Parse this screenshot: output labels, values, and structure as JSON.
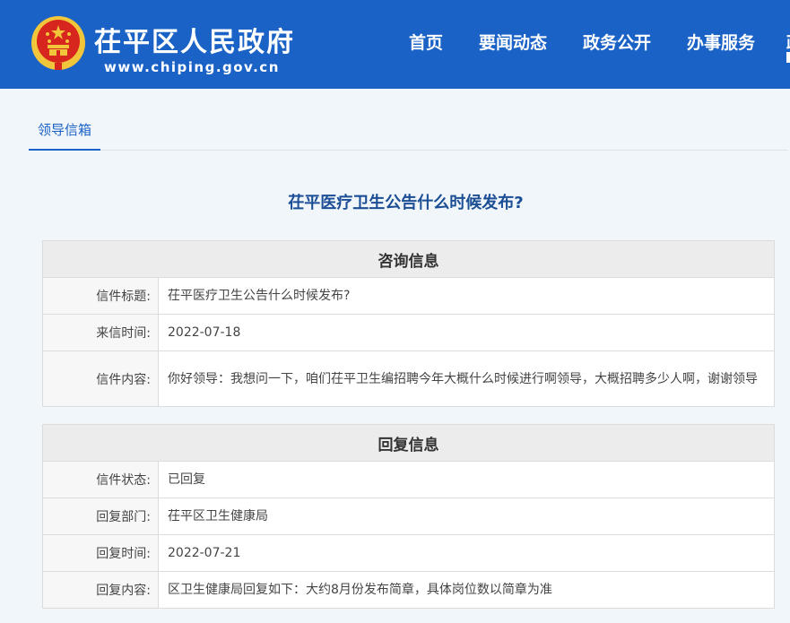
{
  "header": {
    "site_name": "茌平区人民政府",
    "site_url": "www.chiping.gov.cn",
    "nav": [
      "首页",
      "要闻动态",
      "政务公开",
      "办事服务"
    ],
    "nav_overflow": "政"
  },
  "tabs": {
    "active": "领导信箱"
  },
  "letter_title": "茌平医疗卫生公告什么时候发布?",
  "consult": {
    "heading": "咨询信息",
    "rows": [
      {
        "label": "信件标题:",
        "value": "茌平医疗卫生公告什么时候发布?"
      },
      {
        "label": "来信时间:",
        "value": "2022-07-18"
      },
      {
        "label": "信件内容:",
        "value": "你好领导：我想问一下，咱们茌平卫生编招聘今年大概什么时候进行啊领导，大概招聘多少人啊，谢谢领导"
      }
    ]
  },
  "reply": {
    "heading": "回复信息",
    "rows": [
      {
        "label": "信件状态:",
        "value": "已回复"
      },
      {
        "label": "回复部门:",
        "value": "茌平区卫生健康局"
      },
      {
        "label": "回复时间:",
        "value": "2022-07-21"
      },
      {
        "label": "回复内容:",
        "value": "区卫生健康局回复如下：大约8月份发布简章，具体岗位数以简章为准"
      }
    ]
  },
  "colors": {
    "header_bg": "#1a62c6",
    "title": "#1b4e94",
    "page_bg": "#f1f6fb",
    "emblem_red": "#d7261e",
    "emblem_gold": "#f2c63b"
  }
}
